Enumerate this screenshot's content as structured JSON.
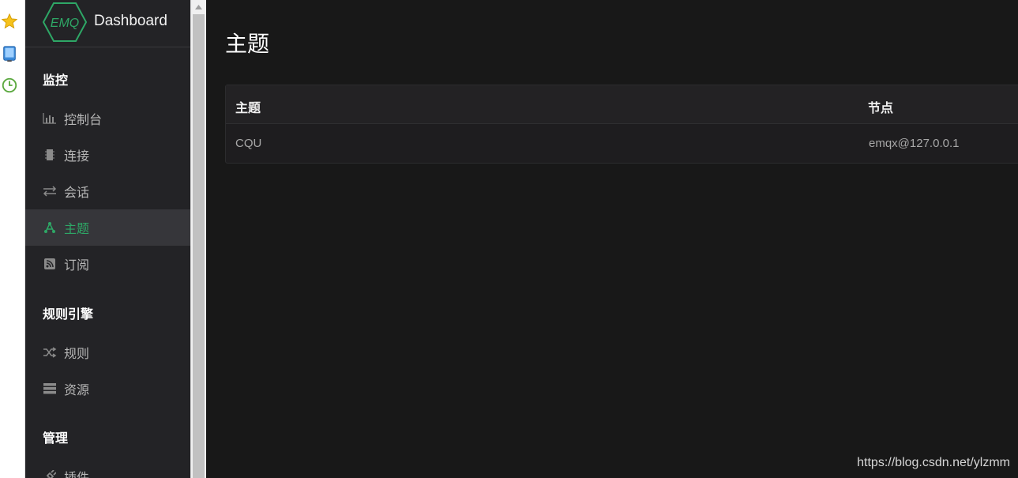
{
  "browser_strip": {
    "icons": [
      "star-icon",
      "tablet-icon",
      "history-clock-icon"
    ]
  },
  "brand": {
    "logo_text": "EMQ",
    "name": "Dashboard"
  },
  "sidebar": {
    "sections": [
      {
        "title": "监控",
        "items": [
          {
            "label": "控制台",
            "icon": "bar-chart-icon"
          },
          {
            "label": "连接",
            "icon": "chip-icon"
          },
          {
            "label": "会话",
            "icon": "swap-arrows-icon"
          },
          {
            "label": "主题",
            "icon": "topic-nodes-icon",
            "active": true
          },
          {
            "label": "订阅",
            "icon": "rss-icon"
          }
        ]
      },
      {
        "title": "规则引擎",
        "items": [
          {
            "label": "规则",
            "icon": "shuffle-icon"
          },
          {
            "label": "资源",
            "icon": "server-stack-icon"
          }
        ]
      },
      {
        "title": "管理",
        "items": [
          {
            "label": "插件",
            "icon": "plug-icon"
          }
        ]
      }
    ]
  },
  "main": {
    "title": "主题",
    "table": {
      "headers": [
        "主题",
        "节点"
      ],
      "rows": [
        [
          "CQU",
          "emqx@127.0.0.1"
        ]
      ]
    }
  },
  "watermark": "https://blog.csdn.net/ylzmm",
  "colors": {
    "accent": "#2ea766",
    "sidebar_bg": "#232326",
    "main_bg": "#181818"
  }
}
